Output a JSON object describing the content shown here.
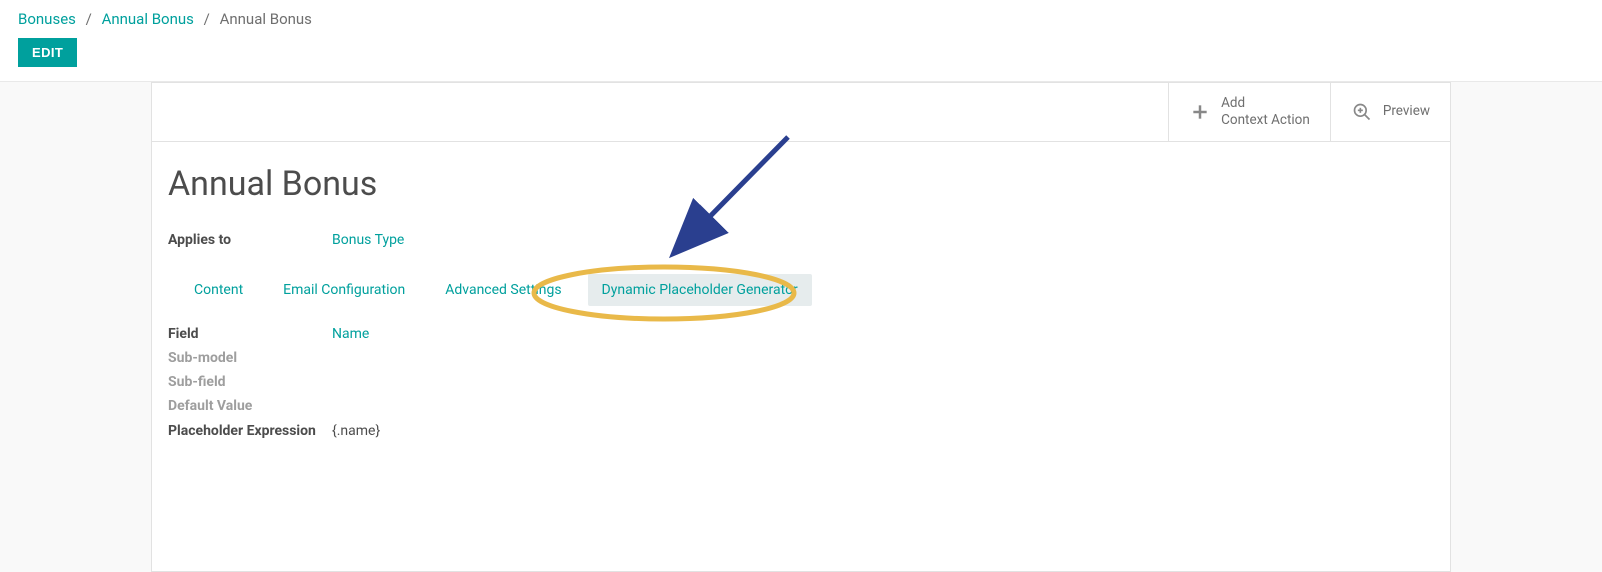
{
  "breadcrumb": {
    "items": [
      "Bonuses",
      "Annual Bonus",
      "Annual Bonus"
    ]
  },
  "buttons": {
    "edit": "EDIT",
    "add_context_line1": "Add",
    "add_context_line2": "Context Action",
    "preview": "Preview"
  },
  "title": "Annual Bonus",
  "applies_to": {
    "label": "Applies to",
    "value": "Bonus Type"
  },
  "tabs": {
    "content": "Content",
    "email_config": "Email Configuration",
    "advanced": "Advanced Settings",
    "dyn_placeholder": "Dynamic Placeholder Generator"
  },
  "fields": {
    "field": {
      "label": "Field",
      "value": "Name"
    },
    "sub_model": {
      "label": "Sub-model",
      "value": ""
    },
    "sub_field": {
      "label": "Sub-field",
      "value": ""
    },
    "default_value": {
      "label": "Default Value",
      "value": ""
    },
    "placeholder_expr": {
      "label": "Placeholder Expression",
      "value": "{.name}"
    }
  }
}
